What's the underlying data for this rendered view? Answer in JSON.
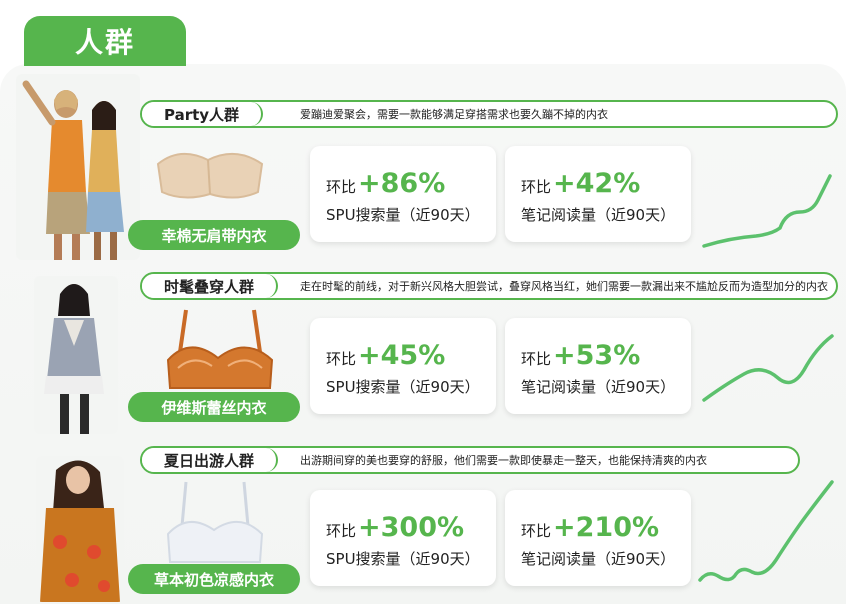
{
  "page": {
    "title": "人群"
  },
  "colors": {
    "accent": "#56b54d",
    "card_bg": "#ffffff",
    "panel_bg": "#f4f6f4"
  },
  "sections": [
    {
      "segment": "Party人群",
      "description": "爱蹦迪爱聚会，需要一款能够满足穿搭需求也要久蹦不掉的内衣",
      "product": "幸棉无肩带内衣",
      "metrics": [
        {
          "prefix": "环比",
          "value": "+86%",
          "label": "SPU搜索量（近90天）"
        },
        {
          "prefix": "环比",
          "value": "+42%",
          "label": "笔记阅读量（近90天）"
        }
      ]
    },
    {
      "segment": "时髦叠穿人群",
      "description": "走在时髦的前线，对于新兴风格大胆尝试，叠穿风格当红，她们需要一款漏出来不尴尬反而为造型加分的内衣",
      "product": "伊维斯蕾丝内衣",
      "metrics": [
        {
          "prefix": "环比",
          "value": "+45%",
          "label": "SPU搜索量（近90天）"
        },
        {
          "prefix": "环比",
          "value": "+53%",
          "label": "笔记阅读量（近90天）"
        }
      ]
    },
    {
      "segment": "夏日出游人群",
      "description": "出游期间穿的美也要穿的舒服，他们需要一款即使暴走一整天，也能保持清爽的内衣",
      "product": "草本初色凉感内衣",
      "metrics": [
        {
          "prefix": "环比",
          "value": "+300%",
          "label": "SPU搜索量（近90天）"
        },
        {
          "prefix": "环比",
          "value": "+210%",
          "label": "笔记阅读量（近90天）"
        }
      ]
    }
  ]
}
